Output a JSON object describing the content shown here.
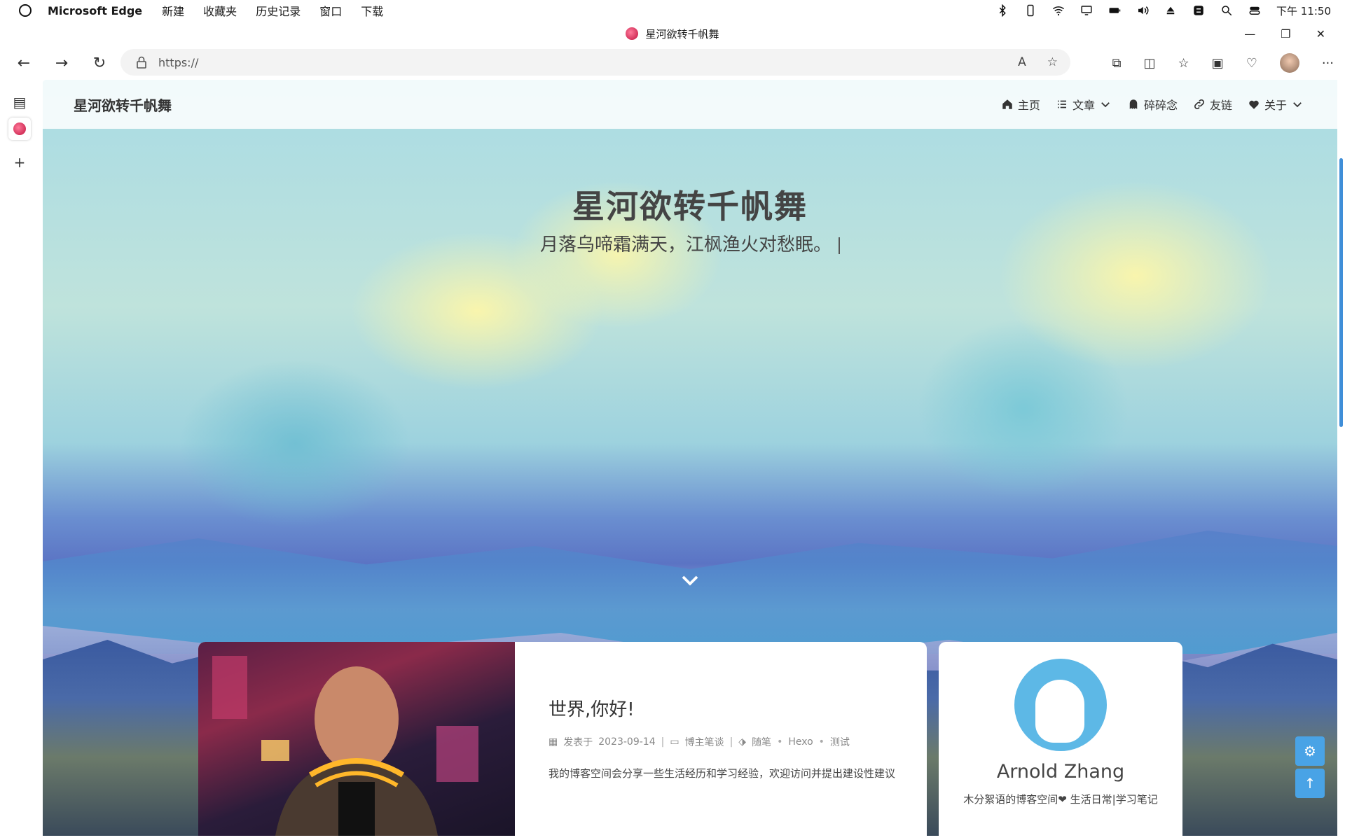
{
  "menubar": {
    "app_name": "Microsoft Edge",
    "items": [
      "新建",
      "收藏夹",
      "历史记录",
      "窗口",
      "下载"
    ],
    "clock": "下午 11:50"
  },
  "window": {
    "tab_title": "星河欲转千帆舞"
  },
  "toolbar": {
    "url": "https://"
  },
  "site": {
    "title": "星河欲转千帆舞",
    "nav": [
      {
        "label": "主页",
        "icon": "home-icon"
      },
      {
        "label": "文章",
        "icon": "list-icon"
      },
      {
        "label": "碎碎念",
        "icon": "ghost-icon"
      },
      {
        "label": "友链",
        "icon": "link-icon"
      },
      {
        "label": "关于",
        "icon": "heart-icon"
      }
    ]
  },
  "hero": {
    "title": "星河欲转千帆舞",
    "subtitle": "月落乌啼霜满天，江枫渔火对愁眠。"
  },
  "post": {
    "title": "世界,你好!",
    "meta": {
      "date_prefix": "发表于",
      "date": "2023-09-14",
      "category": "博主笔谈",
      "tags": [
        "随笔",
        "Hexo",
        "测试"
      ]
    },
    "excerpt": "我的博客空间会分享一些生活经历和学习经验，欢迎访问并提出建设性建议"
  },
  "author": {
    "name": "Arnold Zhang",
    "bio": "木分絮语的博客空间❤ 生活日常|学习笔记"
  },
  "colors": {
    "accent": "#49a3e6",
    "scroll_thumb": "#3f8ed8"
  }
}
